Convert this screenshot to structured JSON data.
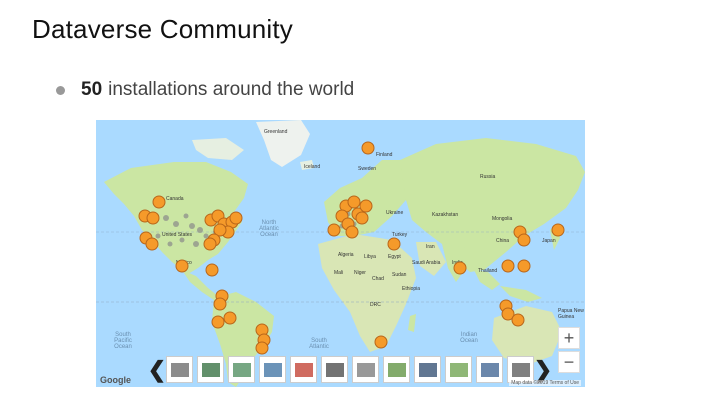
{
  "slide": {
    "title": "Dataverse Community",
    "bullet_count": "50",
    "bullet_text": "installations around the world"
  },
  "map": {
    "labels": {
      "greenland": "Greenland",
      "iceland": "Iceland",
      "finland": "Finland",
      "sweden": "Sweden",
      "russia": "Russia",
      "canada": "Canada",
      "united_states": "United States",
      "mexico": "Mexico",
      "north_atlantic": "North Atlantic Ocean",
      "south_pacific": "South Pacific Ocean",
      "south_atlantic": "South Atlantic",
      "indian_ocean": "Indian Ocean",
      "kazakhstan": "Kazakhstan",
      "mongolia": "Mongolia",
      "china": "China",
      "japan": "Japan",
      "turkey": "Turkey",
      "iran": "Iran",
      "algeria": "Algeria",
      "libya": "Libya",
      "egypt": "Egypt",
      "saudi_arabia": "Saudi Arabia",
      "mali": "Mali",
      "niger": "Niger",
      "chad": "Chad",
      "sudan": "Sudan",
      "ethiopia": "Ethiopia",
      "drc": "DRC",
      "india": "India",
      "thailand": "Thailand",
      "ukraine": "Ukraine",
      "papua": "Papua New Guinea"
    },
    "zoom_in": "+",
    "zoom_out": "−",
    "google": "Google",
    "attribution": "Map data ©2019   Terms of Use"
  },
  "carousel": {
    "prev": "❮",
    "next": "❯",
    "logos": [
      "logo-1",
      "logo-2",
      "logo-3",
      "logo-4",
      "logo-5",
      "logo-6",
      "logo-7",
      "logo-8",
      "logo-9",
      "logo-10",
      "logo-11",
      "logo-12"
    ]
  },
  "colors": {
    "ocean": "#aadaff",
    "land": "#cbe6a3",
    "pin": "#f59a2a"
  }
}
